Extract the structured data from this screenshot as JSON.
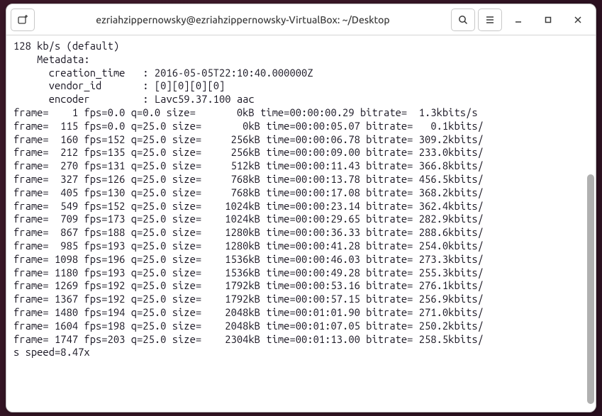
{
  "titlebar": {
    "title": "ezriahzippernowsky@ezriahzippernowsky-VirtualBox: ~/Desktop"
  },
  "header": {
    "line1": "128 kb/s (default)",
    "line2": "    Metadata:",
    "line3": "      creation_time   : 2016-05-05T22:10:40.000000Z",
    "line4": "      vendor_id       : [0][0][0][0]",
    "line5": "      encoder         : Lavc59.37.100 aac"
  },
  "frames": [
    {
      "frame": "1",
      "fps": "0.0",
      "q": "0.0",
      "size": "0kB",
      "time": "00:00:00.29",
      "bitrate": "1.3kbits/s"
    },
    {
      "frame": "115",
      "fps": "0.0",
      "q": "25.0",
      "size": "0kB",
      "time": "00:00:05.07",
      "bitrate": "0.1kbits/"
    },
    {
      "frame": "160",
      "fps": "152",
      "q": "25.0",
      "size": "256kB",
      "time": "00:00:06.78",
      "bitrate": "309.2kbits/"
    },
    {
      "frame": "212",
      "fps": "135",
      "q": "25.0",
      "size": "256kB",
      "time": "00:00:09.00",
      "bitrate": "233.0kbits/"
    },
    {
      "frame": "270",
      "fps": "131",
      "q": "25.0",
      "size": "512kB",
      "time": "00:00:11.43",
      "bitrate": "366.8kbits/"
    },
    {
      "frame": "327",
      "fps": "126",
      "q": "25.0",
      "size": "768kB",
      "time": "00:00:13.78",
      "bitrate": "456.5kbits/"
    },
    {
      "frame": "405",
      "fps": "130",
      "q": "25.0",
      "size": "768kB",
      "time": "00:00:17.08",
      "bitrate": "368.2kbits/"
    },
    {
      "frame": "549",
      "fps": "152",
      "q": "25.0",
      "size": "1024kB",
      "time": "00:00:23.14",
      "bitrate": "362.4kbits/"
    },
    {
      "frame": "709",
      "fps": "173",
      "q": "25.0",
      "size": "1024kB",
      "time": "00:00:29.65",
      "bitrate": "282.9kbits/"
    },
    {
      "frame": "867",
      "fps": "188",
      "q": "25.0",
      "size": "1280kB",
      "time": "00:00:36.33",
      "bitrate": "288.6kbits/"
    },
    {
      "frame": "985",
      "fps": "193",
      "q": "25.0",
      "size": "1280kB",
      "time": "00:00:41.28",
      "bitrate": "254.0kbits/"
    },
    {
      "frame": "1098",
      "fps": "196",
      "q": "25.0",
      "size": "1536kB",
      "time": "00:00:46.03",
      "bitrate": "273.3kbits/"
    },
    {
      "frame": "1180",
      "fps": "193",
      "q": "25.0",
      "size": "1536kB",
      "time": "00:00:49.28",
      "bitrate": "255.3kbits/"
    },
    {
      "frame": "1269",
      "fps": "192",
      "q": "25.0",
      "size": "1792kB",
      "time": "00:00:53.16",
      "bitrate": "276.1kbits/"
    },
    {
      "frame": "1367",
      "fps": "192",
      "q": "25.0",
      "size": "1792kB",
      "time": "00:00:57.15",
      "bitrate": "256.9kbits/"
    },
    {
      "frame": "1480",
      "fps": "194",
      "q": "25.0",
      "size": "2048kB",
      "time": "00:01:01.90",
      "bitrate": "271.0kbits/"
    },
    {
      "frame": "1604",
      "fps": "198",
      "q": "25.0",
      "size": "2048kB",
      "time": "00:01:07.05",
      "bitrate": "250.2kbits/"
    },
    {
      "frame": "1747",
      "fps": "203",
      "q": "25.0",
      "size": "2304kB",
      "time": "00:01:13.00",
      "bitrate": "258.5kbits/"
    }
  ],
  "footer": {
    "line": "s speed=8.47x"
  }
}
